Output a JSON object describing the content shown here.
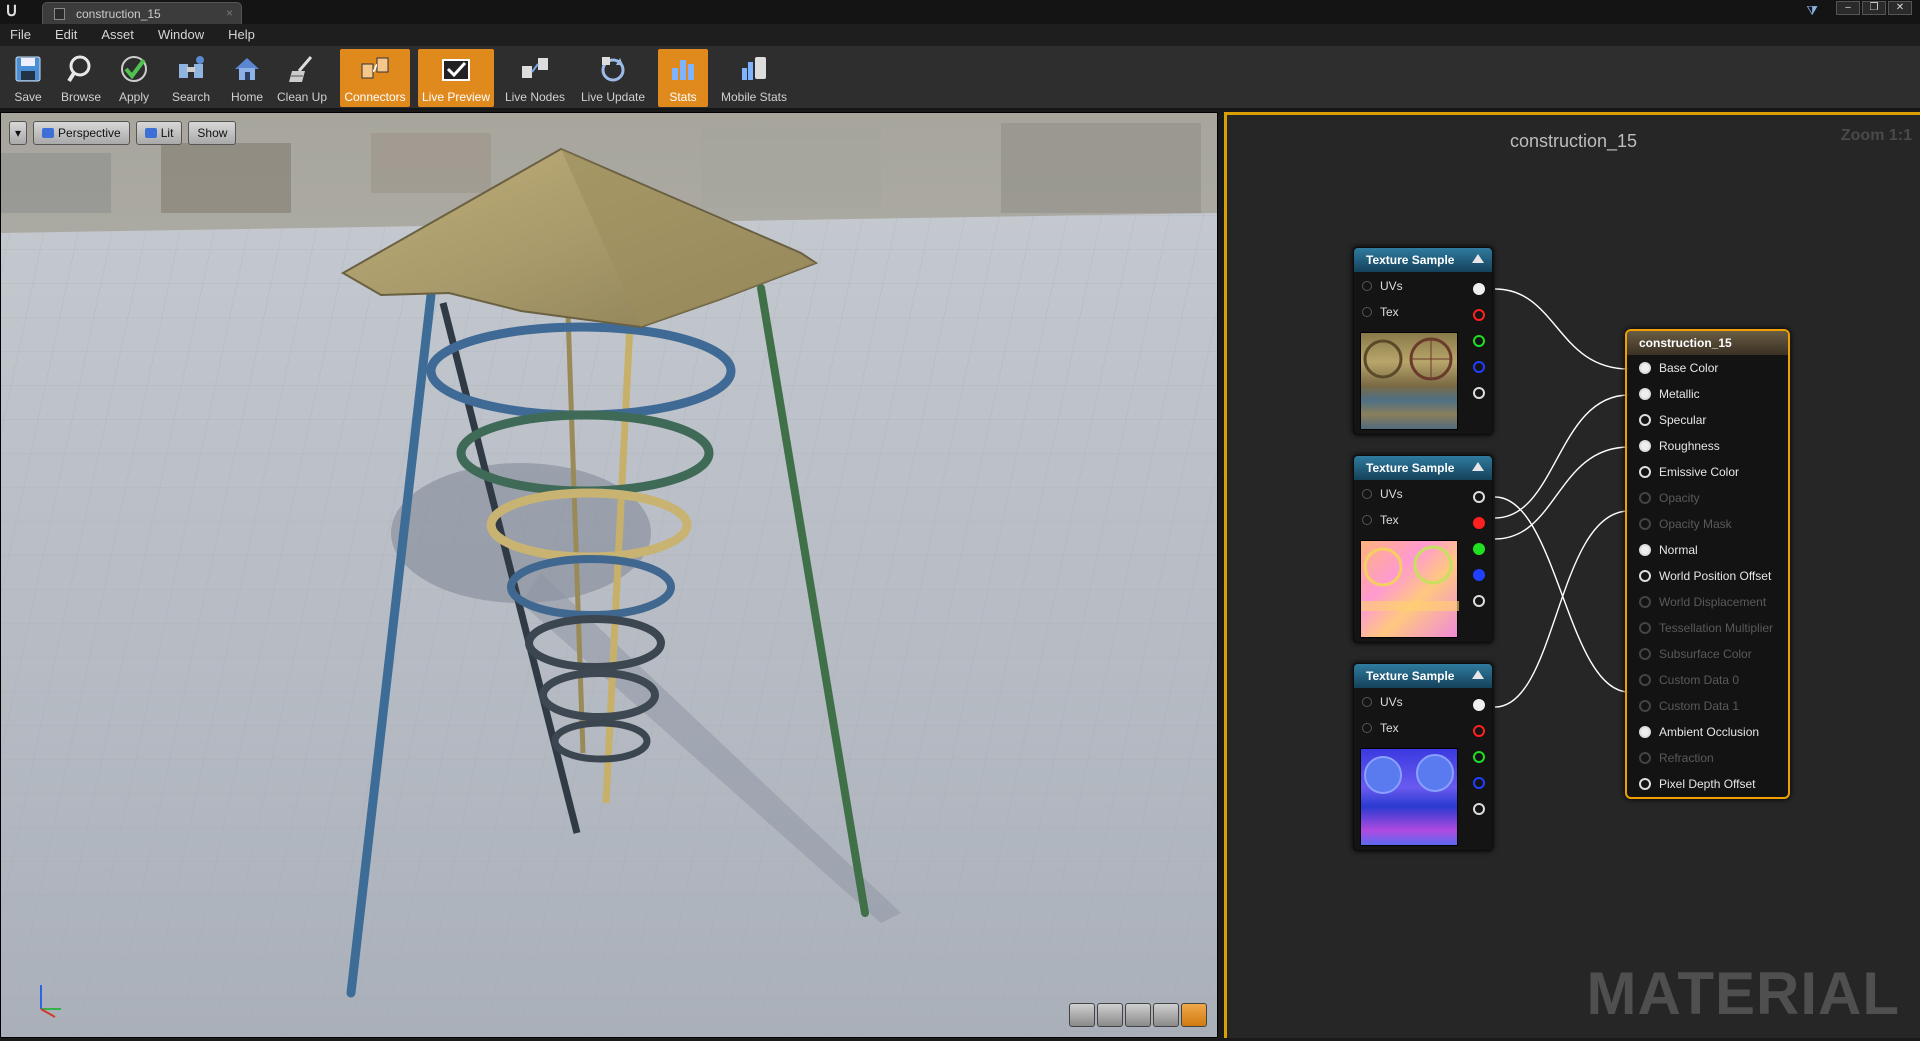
{
  "window": {
    "tab_title": "construction_15",
    "tab_close": "×",
    "controls": [
      "–",
      "❐",
      "✕"
    ]
  },
  "menu": [
    "File",
    "Edit",
    "Asset",
    "Window",
    "Help"
  ],
  "toolbar": [
    {
      "label": "Save",
      "icon": "save-icon",
      "active": false
    },
    {
      "label": "Browse",
      "icon": "browse-icon",
      "active": false
    },
    {
      "label": "Apply",
      "icon": "apply-icon",
      "active": false
    },
    {
      "label": "Search",
      "icon": "search-icon",
      "active": false
    },
    {
      "label": "Home",
      "icon": "home-icon",
      "active": false
    },
    {
      "label": "Clean Up",
      "icon": "cleanup-icon",
      "active": false
    },
    {
      "label": "Connectors",
      "icon": "connectors-icon",
      "active": true
    },
    {
      "label": "Live Preview",
      "icon": "live-preview-icon",
      "active": true
    },
    {
      "label": "Live Nodes",
      "icon": "live-nodes-icon",
      "active": false
    },
    {
      "label": "Live Update",
      "icon": "live-update-icon",
      "active": false
    },
    {
      "label": "Stats",
      "icon": "stats-icon",
      "active": true
    },
    {
      "label": "Mobile Stats",
      "icon": "mobile-stats-icon",
      "active": false
    }
  ],
  "viewport": {
    "view_mode": "Perspective",
    "lighting": "Lit",
    "show": "Show",
    "colors": {
      "accent": "#e08a1e",
      "lit_icon": "#3d6fd6"
    }
  },
  "graph": {
    "title": "construction_15",
    "zoom": "Zoom 1:1",
    "watermark": "MATERIAL",
    "texture_nodes": [
      {
        "title": "Texture Sample",
        "inputs": [
          "UVs",
          "Tex"
        ],
        "thumb": "basecolor"
      },
      {
        "title": "Texture Sample",
        "inputs": [
          "UVs",
          "Tex"
        ],
        "thumb": "orm"
      },
      {
        "title": "Texture Sample",
        "inputs": [
          "UVs",
          "Tex"
        ],
        "thumb": "normal"
      }
    ],
    "result_node": {
      "title": "construction_15",
      "inputs": [
        {
          "label": "Base Color",
          "enabled": true,
          "connected": true
        },
        {
          "label": "Metallic",
          "enabled": true,
          "connected": true
        },
        {
          "label": "Specular",
          "enabled": true,
          "connected": false
        },
        {
          "label": "Roughness",
          "enabled": true,
          "connected": true
        },
        {
          "label": "Emissive Color",
          "enabled": true,
          "connected": false
        },
        {
          "label": "Opacity",
          "enabled": false,
          "connected": false
        },
        {
          "label": "Opacity Mask",
          "enabled": false,
          "connected": false
        },
        {
          "label": "Normal",
          "enabled": true,
          "connected": true
        },
        {
          "label": "World Position Offset",
          "enabled": true,
          "connected": false
        },
        {
          "label": "World Displacement",
          "enabled": false,
          "connected": false
        },
        {
          "label": "Tessellation Multiplier",
          "enabled": false,
          "connected": false
        },
        {
          "label": "Subsurface Color",
          "enabled": false,
          "connected": false
        },
        {
          "label": "Custom Data 0",
          "enabled": false,
          "connected": false
        },
        {
          "label": "Custom Data 1",
          "enabled": false,
          "connected": false
        },
        {
          "label": "Ambient Occlusion",
          "enabled": true,
          "connected": true
        },
        {
          "label": "Refraction",
          "enabled": false,
          "connected": false
        },
        {
          "label": "Pixel Depth Offset",
          "enabled": true,
          "connected": false
        }
      ]
    },
    "pin_colors": [
      "#eeeeee",
      "#ff2020",
      "#20e020",
      "#2040ff",
      "#dddddd"
    ]
  }
}
